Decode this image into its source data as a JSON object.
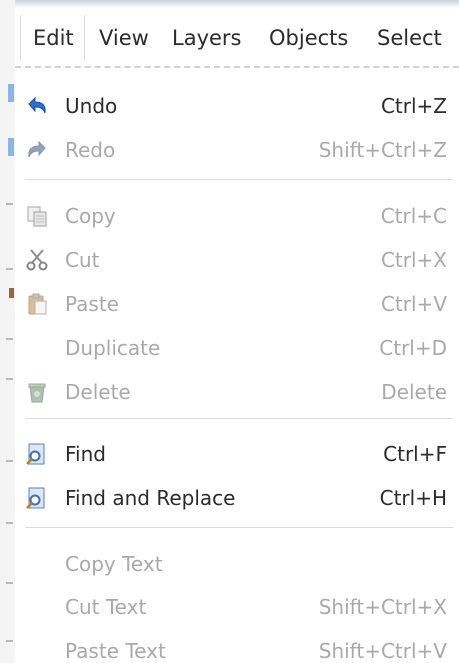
{
  "menubar": {
    "items": [
      {
        "label": "Edit"
      },
      {
        "label": "View"
      },
      {
        "label": "Layers"
      },
      {
        "label": "Objects"
      },
      {
        "label": "Select"
      }
    ],
    "active": "Edit"
  },
  "edit_menu": {
    "items": [
      {
        "label": "Undo",
        "shortcut": "Ctrl+Z",
        "enabled": true,
        "icon": "undo-icon"
      },
      {
        "label": "Redo",
        "shortcut": "Shift+Ctrl+Z",
        "enabled": false,
        "icon": "redo-icon"
      },
      {
        "label": "Copy",
        "shortcut": "Ctrl+C",
        "enabled": false,
        "icon": "copy-icon"
      },
      {
        "label": "Cut",
        "shortcut": "Ctrl+X",
        "enabled": false,
        "icon": "scissors-icon"
      },
      {
        "label": "Paste",
        "shortcut": "Ctrl+V",
        "enabled": false,
        "icon": "paste-icon"
      },
      {
        "label": "Duplicate",
        "shortcut": "Ctrl+D",
        "enabled": false,
        "icon": ""
      },
      {
        "label": "Delete",
        "shortcut": "Delete",
        "enabled": false,
        "icon": "trash-icon"
      },
      {
        "label": "Find",
        "shortcut": "Ctrl+F",
        "enabled": true,
        "icon": "find-icon"
      },
      {
        "label": "Find and Replace",
        "shortcut": "Ctrl+H",
        "enabled": true,
        "icon": "find-replace-icon"
      },
      {
        "label": "Copy Text",
        "shortcut": "",
        "enabled": false,
        "icon": ""
      },
      {
        "label": "Cut Text",
        "shortcut": "Shift+Ctrl+X",
        "enabled": false,
        "icon": ""
      },
      {
        "label": "Paste Text",
        "shortcut": "Shift+Ctrl+V",
        "enabled": false,
        "icon": ""
      }
    ]
  },
  "colors": {
    "enabled_text": "#2b2b2b",
    "disabled_text": "#a9a9a9",
    "undo_icon": "#2f6fcf",
    "separator": "#dcdcdc"
  }
}
